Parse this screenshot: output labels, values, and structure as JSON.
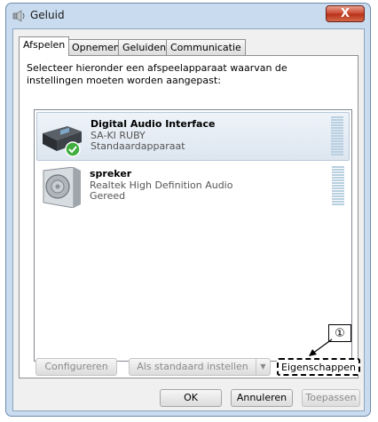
{
  "window": {
    "title": "Geluid",
    "close_label": "X"
  },
  "tabs": [
    {
      "label": "Afspelen"
    },
    {
      "label": "Opnemen"
    },
    {
      "label": "Geluiden"
    },
    {
      "label": "Communicatie"
    }
  ],
  "instruction": "Selecteer hieronder een afspeelapparaat waarvan de instellingen moeten worden aangepast:",
  "devices": [
    {
      "name": "Digital Audio Interface",
      "sub": "SA-KI RUBY",
      "status": "Standaardapparaat",
      "icon": "audio-interface-icon",
      "is_default": true
    },
    {
      "name": "spreker",
      "sub": "Realtek High Definition Audio",
      "status": "Gereed",
      "icon": "speaker-icon",
      "is_default": false
    }
  ],
  "buttons": {
    "configure": "Configureren",
    "set_default": "Als standaard instellen",
    "properties": "Eigenschappen",
    "ok": "OK",
    "cancel": "Annuleren",
    "apply": "Toepassen"
  },
  "callout_marker": "①",
  "colors": {
    "window_frame": "#c9dbee",
    "selection": "#dde6f0",
    "close_button": "#c8452c",
    "default_check": "#3fae3f"
  }
}
